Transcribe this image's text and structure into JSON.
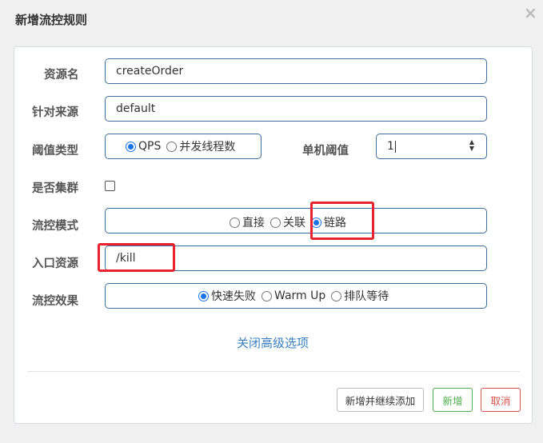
{
  "dialog": {
    "title": "新增流控规则"
  },
  "form": {
    "resource_name": {
      "label": "资源名",
      "value": "createOrder"
    },
    "limit_app": {
      "label": "针对来源",
      "value": "default"
    },
    "threshold_type": {
      "label": "阈值类型",
      "options": [
        "QPS",
        "并发线程数"
      ],
      "selected": "QPS"
    },
    "single_threshold": {
      "label": "单机阈值",
      "value": "1"
    },
    "cluster": {
      "label": "是否集群",
      "checked": false
    },
    "flow_mode": {
      "label": "流控模式",
      "options": [
        "直接",
        "关联",
        "链路"
      ],
      "selected": "链路"
    },
    "entry_resource": {
      "label": "入口资源",
      "value": "/kill"
    },
    "flow_effect": {
      "label": "流控效果",
      "options": [
        "快速失败",
        "Warm Up",
        "排队等待"
      ],
      "selected": "快速失败"
    },
    "advanced_link": "关闭高级选项"
  },
  "footer": {
    "add_continue": "新增并继续添加",
    "add": "新增",
    "cancel": "取消"
  },
  "colors": {
    "field_border": "#3f6e9c",
    "highlight": "#e8232d",
    "link": "#3a80c0",
    "add_button": "#4cae4c",
    "cancel_button": "#d9534f"
  }
}
